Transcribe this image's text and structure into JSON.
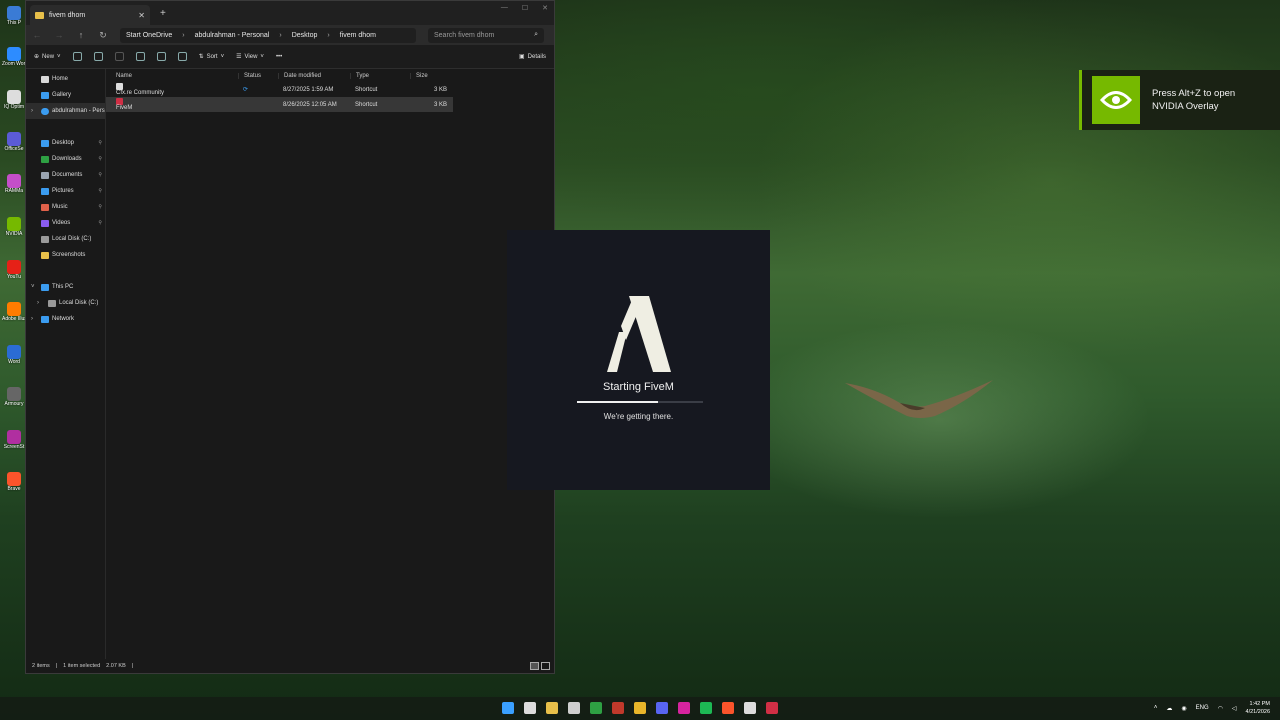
{
  "desktop": {
    "icons": [
      {
        "label": "This P",
        "color": "#3a7bd5"
      },
      {
        "label": "Zoom Workpl",
        "color": "#2d8cff"
      },
      {
        "label": "IQ Optim",
        "color": "#dddddd"
      },
      {
        "label": "OfficeSe",
        "color": "#5b5bd6"
      },
      {
        "label": "RAMMa",
        "color": "#c44fc9"
      },
      {
        "label": "NVIDIA",
        "color": "#76b900"
      },
      {
        "label": "YouTu",
        "color": "#e62117"
      },
      {
        "label": "Adobe Illustrat",
        "color": "#ff7c00"
      },
      {
        "label": "Word",
        "color": "#2b6cd4"
      },
      {
        "label": "Armoury",
        "color": "#666666"
      },
      {
        "label": "ScreenSt",
        "color": "#b02fa0"
      },
      {
        "label": "Brave",
        "color": "#fb542b"
      }
    ]
  },
  "explorer": {
    "tab_title": "fivem dhom",
    "breadcrumbs": [
      "Start OneDrive",
      "abdulrahman - Personal",
      "Desktop",
      "fivem dhom"
    ],
    "search_placeholder": "Search fivem dhom",
    "toolbar": {
      "new": "New",
      "sort": "Sort",
      "view": "View",
      "more": "•••",
      "details": "Details"
    },
    "nav_pane": {
      "home": "Home",
      "gallery": "Gallery",
      "onedrive": "abdulrahman - Pers",
      "quick": [
        "Desktop",
        "Downloads",
        "Documents",
        "Pictures",
        "Music",
        "Videos",
        "Local Disk (C:)",
        "Screenshots"
      ],
      "this_pc": "This PC",
      "local_disk": "Local Disk (C:)",
      "network": "Network"
    },
    "columns": {
      "name": "Name",
      "status": "Status",
      "date": "Date modified",
      "type": "Type",
      "size": "Size"
    },
    "files": [
      {
        "name": "Cfx.re Community",
        "status": "⟳",
        "date": "8/27/2025 1:59 AM",
        "type": "Shortcut",
        "size": "3 KB",
        "selected": false
      },
      {
        "name": "FiveM",
        "status": "",
        "date": "8/26/2025 12:05 AM",
        "type": "Shortcut",
        "size": "3 KB",
        "selected": true
      }
    ],
    "status": {
      "count": "2 items",
      "selected": "1 item selected",
      "size": "2.07 KB"
    }
  },
  "splash": {
    "title": "Starting FiveM",
    "subtitle": "We're getting there.",
    "progress": 0.64
  },
  "toast": {
    "line1": "Press Alt+Z to open",
    "line2": "NVIDIA Overlay"
  },
  "taskbar": {
    "apps": [
      {
        "name": "start-icon",
        "color": "#3aa0ff"
      },
      {
        "name": "search-icon",
        "color": "#dddddd"
      },
      {
        "name": "file-explorer-icon",
        "color": "#e8c04a"
      },
      {
        "name": "store-icon",
        "color": "#cfcfcf"
      },
      {
        "name": "xbox-icon",
        "color": "#2ea043"
      },
      {
        "name": "app-red-icon",
        "color": "#c0392b"
      },
      {
        "name": "chrome-icon",
        "color": "#e8b62a"
      },
      {
        "name": "discord-icon",
        "color": "#5865f2"
      },
      {
        "name": "instagram-icon",
        "color": "#d6249f"
      },
      {
        "name": "spotify-icon",
        "color": "#1db954"
      },
      {
        "name": "brave-icon",
        "color": "#fb542b"
      },
      {
        "name": "steam-icon",
        "color": "#dddddd"
      },
      {
        "name": "fivem-icon",
        "color": "#d12f45"
      }
    ],
    "lang": "ENG",
    "time": "1:42 PM",
    "date": "4/21/2026"
  }
}
